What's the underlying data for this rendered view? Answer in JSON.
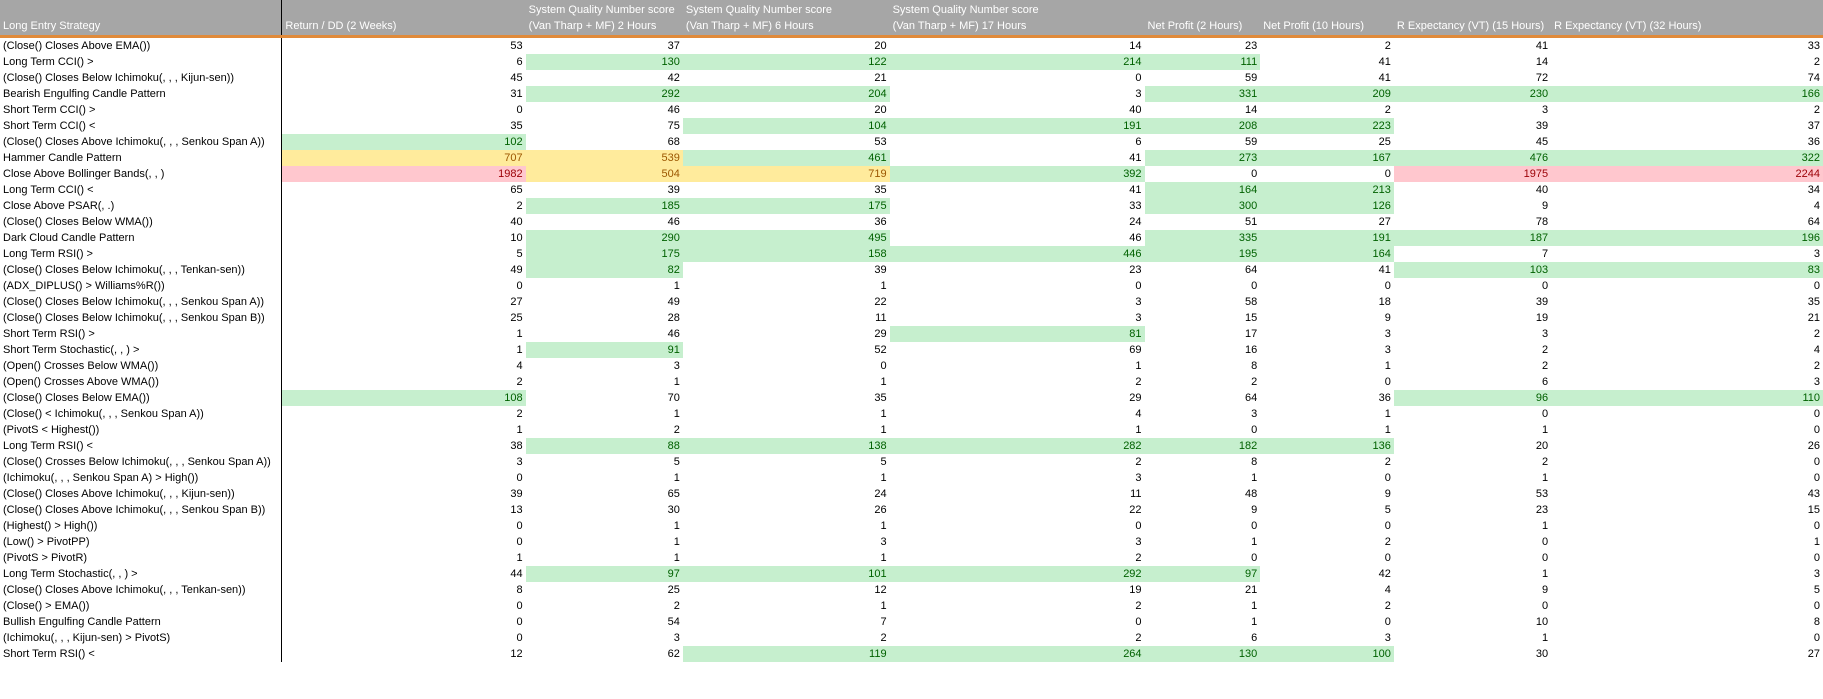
{
  "headers": [
    "Long Entry Strategy",
    "Return / DD (2 Weeks)",
    "System Quality Number score (Van Tharp + MF) 2 Hours",
    "System Quality Number score (Van Tharp + MF) 6 Hours",
    "System Quality Number score (Van Tharp + MF) 17 Hours",
    "Net Profit (2 Hours)",
    "Net Profit (10 Hours)",
    "R Expectancy (VT) (15 Hours)",
    "R Expectancy (VT) (32 Hours)"
  ],
  "header_lines": {
    "sqn_line1": "System Quality Number score",
    "sqn2_line2": "(Van Tharp + MF) 2 Hours",
    "sqn6_line2": "(Van Tharp + MF) 6 Hours",
    "sqn17_line2": "(Van Tharp + MF) 17 Hours"
  },
  "highlight_colors": {
    "green_fill": "#c6efce",
    "green_text": "#006100",
    "yellow_fill": "#ffeb9c",
    "yellow_text": "#9c5700",
    "red_fill": "#ffc7ce",
    "red_text": "#9c0006",
    "header_fill": "#a6a6a6",
    "header_underline": "#e08a3a"
  },
  "rows": [
    {
      "name": "(Close() Closes Above EMA())",
      "v": [
        53,
        37,
        20,
        14,
        23,
        2,
        41,
        33
      ],
      "h": [
        "",
        "",
        "",
        "",
        "",
        "",
        "",
        ""
      ]
    },
    {
      "name": "Long Term CCI() >",
      "v": [
        6,
        130,
        122,
        214,
        111,
        41,
        14,
        2
      ],
      "h": [
        "",
        "g",
        "g",
        "g",
        "g",
        "",
        "",
        ""
      ]
    },
    {
      "name": "(Close() Closes Below Ichimoku(, , , Kijun-sen))",
      "v": [
        45,
        42,
        21,
        0,
        59,
        41,
        72,
        74
      ],
      "h": [
        "",
        "",
        "",
        "",
        "",
        "",
        "",
        ""
      ]
    },
    {
      "name": "Bearish Engulfing Candle Pattern",
      "v": [
        31,
        292,
        204,
        3,
        331,
        209,
        230,
        166
      ],
      "h": [
        "",
        "g",
        "g",
        "",
        "g",
        "g",
        "g",
        "g"
      ]
    },
    {
      "name": "Short Term CCI() >",
      "v": [
        0,
        46,
        20,
        40,
        14,
        2,
        3,
        2
      ],
      "h": [
        "",
        "",
        "",
        "",
        "",
        "",
        "",
        ""
      ]
    },
    {
      "name": "Short Term CCI() <",
      "v": [
        35,
        75,
        104,
        191,
        208,
        223,
        39,
        37
      ],
      "h": [
        "",
        "",
        "g",
        "g",
        "g",
        "g",
        "",
        ""
      ]
    },
    {
      "name": "(Close() Closes Above Ichimoku(, , , Senkou Span A))",
      "v": [
        102,
        68,
        53,
        6,
        59,
        25,
        45,
        36
      ],
      "h": [
        "g",
        "",
        "",
        "",
        "",
        "",
        "",
        ""
      ]
    },
    {
      "name": "Hammer Candle Pattern",
      "v": [
        707,
        539,
        461,
        41,
        273,
        167,
        476,
        322
      ],
      "h": [
        "y",
        "y",
        "g",
        "",
        "g",
        "g",
        "g",
        "g"
      ]
    },
    {
      "name": "Close Above Bollinger Bands(, , )",
      "v": [
        1982,
        504,
        719,
        392,
        0,
        0,
        1975,
        2244
      ],
      "h": [
        "r",
        "y",
        "y",
        "g",
        "",
        "",
        "r",
        "r"
      ]
    },
    {
      "name": "Long Term CCI() <",
      "v": [
        65,
        39,
        35,
        41,
        164,
        213,
        40,
        34
      ],
      "h": [
        "",
        "",
        "",
        "",
        "g",
        "g",
        "",
        ""
      ]
    },
    {
      "name": "Close Above PSAR(, .)",
      "v": [
        2,
        185,
        175,
        33,
        300,
        126,
        9,
        4
      ],
      "h": [
        "",
        "g",
        "g",
        "",
        "g",
        "g",
        "",
        ""
      ]
    },
    {
      "name": "(Close() Closes Below WMA())",
      "v": [
        40,
        46,
        36,
        24,
        51,
        27,
        78,
        64
      ],
      "h": [
        "",
        "",
        "",
        "",
        "",
        "",
        "",
        ""
      ]
    },
    {
      "name": "Dark Cloud Candle Pattern",
      "v": [
        10,
        290,
        495,
        46,
        335,
        191,
        187,
        196
      ],
      "h": [
        "",
        "g",
        "g",
        "",
        "g",
        "g",
        "g",
        "g"
      ]
    },
    {
      "name": "Long Term RSI() >",
      "v": [
        5,
        175,
        158,
        446,
        195,
        164,
        7,
        3
      ],
      "h": [
        "",
        "g",
        "g",
        "g",
        "g",
        "g",
        "",
        ""
      ]
    },
    {
      "name": "(Close() Closes Below Ichimoku(, , , Tenkan-sen))",
      "v": [
        49,
        82,
        39,
        23,
        64,
        41,
        103,
        83
      ],
      "h": [
        "",
        "g",
        "",
        "",
        "",
        "",
        "g",
        "g"
      ]
    },
    {
      "name": "(ADX_DIPLUS() > Williams%R())",
      "v": [
        0,
        1,
        1,
        0,
        0,
        0,
        0,
        0
      ],
      "h": [
        "",
        "",
        "",
        "",
        "",
        "",
        "",
        ""
      ]
    },
    {
      "name": "(Close() Closes Below Ichimoku(, , , Senkou Span A))",
      "v": [
        27,
        49,
        22,
        3,
        58,
        18,
        39,
        35
      ],
      "h": [
        "",
        "",
        "",
        "",
        "",
        "",
        "",
        ""
      ]
    },
    {
      "name": "(Close() Closes Below Ichimoku(, , , Senkou Span B))",
      "v": [
        25,
        28,
        11,
        3,
        15,
        9,
        19,
        21
      ],
      "h": [
        "",
        "",
        "",
        "",
        "",
        "",
        "",
        ""
      ]
    },
    {
      "name": "Short Term RSI() >",
      "v": [
        1,
        46,
        29,
        81,
        17,
        3,
        3,
        2
      ],
      "h": [
        "",
        "",
        "",
        "g",
        "",
        "",
        "",
        ""
      ]
    },
    {
      "name": "Short Term Stochastic(, , ) >",
      "v": [
        1,
        91,
        52,
        69,
        16,
        3,
        2,
        4
      ],
      "h": [
        "",
        "g",
        "",
        "",
        "",
        "",
        "",
        ""
      ]
    },
    {
      "name": "(Open() Crosses Below WMA())",
      "v": [
        4,
        3,
        0,
        1,
        8,
        1,
        2,
        2
      ],
      "h": [
        "",
        "",
        "",
        "",
        "",
        "",
        "",
        ""
      ]
    },
    {
      "name": "(Open() Crosses Above WMA())",
      "v": [
        2,
        1,
        1,
        2,
        2,
        0,
        6,
        3
      ],
      "h": [
        "",
        "",
        "",
        "",
        "",
        "",
        "",
        ""
      ]
    },
    {
      "name": "(Close() Closes Below EMA())",
      "v": [
        108,
        70,
        35,
        29,
        64,
        36,
        96,
        110
      ],
      "h": [
        "g",
        "",
        "",
        "",
        "",
        "",
        "g",
        "g"
      ]
    },
    {
      "name": "(Close() < Ichimoku(, , , Senkou Span A))",
      "v": [
        2,
        1,
        1,
        4,
        3,
        1,
        0,
        0
      ],
      "h": [
        "",
        "",
        "",
        "",
        "",
        "",
        "",
        ""
      ]
    },
    {
      "name": "(PivotS < Highest())",
      "v": [
        1,
        2,
        1,
        1,
        0,
        1,
        1,
        0
      ],
      "h": [
        "",
        "",
        "",
        "",
        "",
        "",
        "",
        ""
      ]
    },
    {
      "name": "Long Term RSI() <",
      "v": [
        38,
        88,
        138,
        282,
        182,
        136,
        20,
        26
      ],
      "h": [
        "",
        "g",
        "g",
        "g",
        "g",
        "g",
        "",
        ""
      ]
    },
    {
      "name": "(Close() Crosses Below Ichimoku(, , , Senkou Span A))",
      "v": [
        3,
        5,
        5,
        2,
        8,
        2,
        2,
        0
      ],
      "h": [
        "",
        "",
        "",
        "",
        "",
        "",
        "",
        ""
      ]
    },
    {
      "name": "(Ichimoku(, , , Senkou Span A) > High())",
      "v": [
        0,
        1,
        1,
        3,
        1,
        0,
        1,
        0
      ],
      "h": [
        "",
        "",
        "",
        "",
        "",
        "",
        "",
        ""
      ]
    },
    {
      "name": "(Close() Closes Above Ichimoku(, , , Kijun-sen))",
      "v": [
        39,
        65,
        24,
        11,
        48,
        9,
        53,
        43
      ],
      "h": [
        "",
        "",
        "",
        "",
        "",
        "",
        "",
        ""
      ]
    },
    {
      "name": "(Close() Closes Above Ichimoku(, , , Senkou Span B))",
      "v": [
        13,
        30,
        26,
        22,
        9,
        5,
        23,
        15
      ],
      "h": [
        "",
        "",
        "",
        "",
        "",
        "",
        "",
        ""
      ]
    },
    {
      "name": "(Highest() > High())",
      "v": [
        0,
        1,
        1,
        0,
        0,
        0,
        1,
        0
      ],
      "h": [
        "",
        "",
        "",
        "",
        "",
        "",
        "",
        ""
      ]
    },
    {
      "name": "(Low() > PivotPP)",
      "v": [
        0,
        1,
        3,
        3,
        1,
        2,
        0,
        1
      ],
      "h": [
        "",
        "",
        "",
        "",
        "",
        "",
        "",
        ""
      ]
    },
    {
      "name": "(PivotS > PivotR)",
      "v": [
        1,
        1,
        1,
        2,
        0,
        0,
        0,
        0
      ],
      "h": [
        "",
        "",
        "",
        "",
        "",
        "",
        "",
        ""
      ]
    },
    {
      "name": "Long Term Stochastic(, , ) >",
      "v": [
        44,
        97,
        101,
        292,
        97,
        42,
        1,
        3
      ],
      "h": [
        "",
        "g",
        "g",
        "g",
        "g",
        "",
        "",
        ""
      ]
    },
    {
      "name": "(Close() Closes Above Ichimoku(, , , Tenkan-sen))",
      "v": [
        8,
        25,
        12,
        19,
        21,
        4,
        9,
        5
      ],
      "h": [
        "",
        "",
        "",
        "",
        "",
        "",
        "",
        ""
      ]
    },
    {
      "name": "(Close() > EMA())",
      "v": [
        0,
        2,
        1,
        2,
        1,
        2,
        0,
        0
      ],
      "h": [
        "",
        "",
        "",
        "",
        "",
        "",
        "",
        ""
      ]
    },
    {
      "name": "Bullish Engulfing Candle Pattern",
      "v": [
        0,
        54,
        7,
        0,
        1,
        0,
        10,
        8
      ],
      "h": [
        "",
        "",
        "",
        "",
        "",
        "",
        "",
        ""
      ]
    },
    {
      "name": "(Ichimoku(, , , Kijun-sen) > PivotS)",
      "v": [
        0,
        3,
        2,
        2,
        6,
        3,
        1,
        0
      ],
      "h": [
        "",
        "",
        "",
        "",
        "",
        "",
        "",
        ""
      ]
    },
    {
      "name": "Short Term RSI() <",
      "v": [
        12,
        62,
        119,
        264,
        130,
        100,
        30,
        27
      ],
      "h": [
        "",
        "",
        "g",
        "g",
        "g",
        "g",
        "",
        ""
      ]
    }
  ]
}
